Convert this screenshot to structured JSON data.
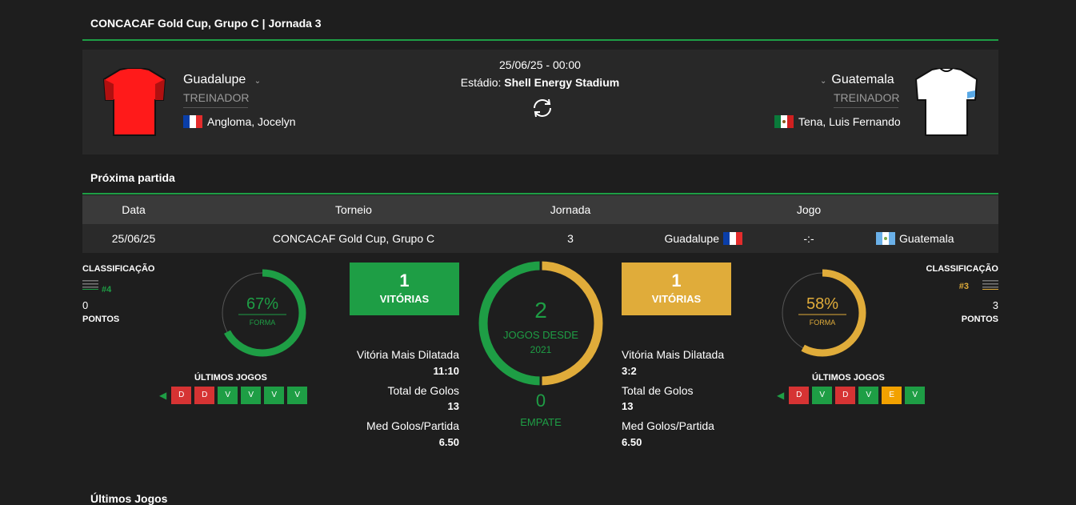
{
  "header": {
    "title": "CONCACAF Gold Cup, Grupo C | Jornada 3"
  },
  "match": {
    "datetime": "25/06/25 - 00:00",
    "stadium_label": "Estádio:",
    "stadium": "Shell Energy Stadium",
    "home": {
      "name": "Guadalupe",
      "coach_label": "TREINADOR",
      "coach": "Angloma, Jocelyn",
      "shirt_color": "#ff1a1a"
    },
    "away": {
      "name": "Guatemala",
      "coach_label": "TREINADOR",
      "coach": "Tena, Luis Fernando",
      "shirt_color": "#ffffff"
    }
  },
  "next_match": {
    "title": "Próxima partida",
    "columns": [
      "Data",
      "Torneio",
      "Jornada",
      "Jogo"
    ],
    "row": {
      "date": "25/06/25",
      "tournament": "CONCACAF Gold Cup, Grupo C",
      "round": "3",
      "home": "Guadalupe",
      "score": "-:-",
      "away": "Guatemala"
    }
  },
  "home_stats": {
    "class_label": "CLASSIFICAÇÃO",
    "rank": "#4",
    "points": "0",
    "points_label": "PONTOS",
    "form_pct": "67%",
    "form_label": "FORMA",
    "form_value": 0.67,
    "last_label": "ÚLTIMOS JOGOS",
    "last": [
      "D",
      "D",
      "V",
      "V",
      "V",
      "V"
    ],
    "wins": "1",
    "wins_label": "VITÓRIAS",
    "biggest_label": "Vitória Mais Dilatada",
    "biggest": "11:10",
    "goals_label": "Total de Golos",
    "goals": "13",
    "avg_label": "Med Golos/Partida",
    "avg": "6.50"
  },
  "away_stats": {
    "class_label": "CLASSIFICAÇÃO",
    "rank": "#3",
    "points": "3",
    "points_label": "PONTOS",
    "form_pct": "58%",
    "form_label": "FORMA",
    "form_value": 0.58,
    "last_label": "ÚLTIMOS JOGOS",
    "last": [
      "D",
      "V",
      "D",
      "V",
      "E",
      "V"
    ],
    "wins": "1",
    "wins_label": "VITÓRIAS",
    "biggest_label": "Vitória Mais Dilatada",
    "biggest": "3:2",
    "goals_label": "Total de Golos",
    "goals": "13",
    "avg_label": "Med Golos/Partida",
    "avg": "6.50"
  },
  "h2h": {
    "games": "2",
    "games_label": "JOGOS DESDE",
    "since": "2021",
    "draws": "0",
    "draws_label": "EMPATE"
  },
  "last_games_title": "Últimos Jogos",
  "colors": {
    "green": "#1e9e45",
    "gold": "#e0ac3a",
    "red": "#d63333",
    "orange": "#f2a100"
  }
}
